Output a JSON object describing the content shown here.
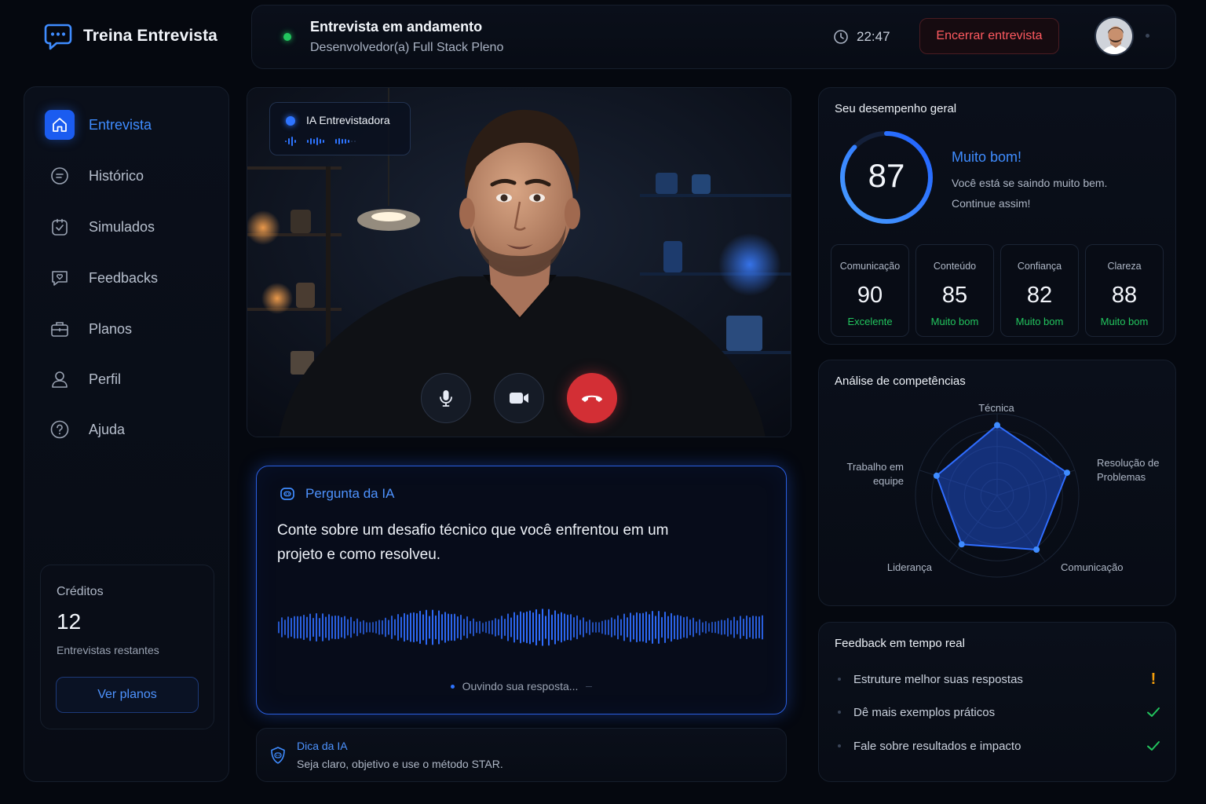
{
  "brand": {
    "name": "Treina Entrevista"
  },
  "header": {
    "status_title": "Entrevista em andamento",
    "position": "Desenvolvedor(a) Full Stack Pleno",
    "timer": "22:47",
    "end_button": "Encerrar entrevista"
  },
  "sidebar": {
    "items": [
      {
        "label": "Entrevista",
        "icon": "home-icon",
        "active": true
      },
      {
        "label": "Histórico",
        "icon": "history-icon",
        "active": false
      },
      {
        "label": "Simulados",
        "icon": "clipboard-check-icon",
        "active": false
      },
      {
        "label": "Feedbacks",
        "icon": "message-heart-icon",
        "active": false
      },
      {
        "label": "Planos",
        "icon": "briefcase-icon",
        "active": false
      },
      {
        "label": "Perfil",
        "icon": "user-icon",
        "active": false
      },
      {
        "label": "Ajuda",
        "icon": "help-circle-icon",
        "active": false
      }
    ],
    "credits": {
      "title": "Créditos",
      "count": "12",
      "subtitle": "Entrevistas restantes",
      "button": "Ver planos"
    }
  },
  "video": {
    "ai_badge": "IA Entrevistadora",
    "controls": [
      "microphone-icon",
      "camera-icon",
      "hang-up-icon"
    ]
  },
  "question": {
    "label": "Pergunta da IA",
    "text": "Conte sobre um desafio técnico que você enfrentou em um projeto e como resolveu.",
    "listening": "Ouvindo sua resposta..."
  },
  "tip": {
    "title": "Dica da IA",
    "text": "Seja claro, objetivo e use o método STAR."
  },
  "performance": {
    "title": "Seu desempenho geral",
    "score": "87",
    "score_fraction": 0.87,
    "headline": "Muito bom!",
    "message": "Você está se saindo muito bem. Continue assim!",
    "metrics": [
      {
        "label": "Comunicação",
        "value": "90",
        "status": "Excelente"
      },
      {
        "label": "Conteúdo",
        "value": "85",
        "status": "Muito bom"
      },
      {
        "label": "Confiança",
        "value": "82",
        "status": "Muito bom"
      },
      {
        "label": "Clareza",
        "value": "88",
        "status": "Muito bom"
      }
    ]
  },
  "competencies": {
    "title": "Análise de competências"
  },
  "chart_data": {
    "type": "radar",
    "categories": [
      "Técnica",
      "Resolução de Problemas",
      "Comunicação",
      "Liderança",
      "Trabalho em equipe"
    ],
    "values": [
      0.86,
      0.9,
      0.82,
      0.74,
      0.78
    ],
    "range": [
      0,
      1
    ],
    "grid": true
  },
  "feedback": {
    "title": "Feedback em tempo real",
    "items": [
      {
        "text": "Estruture melhor suas respostas",
        "status": "warning"
      },
      {
        "text": "Dê mais exemplos práticos",
        "status": "ok"
      },
      {
        "text": "Fale sobre resultados e impacto",
        "status": "ok"
      }
    ]
  },
  "colors": {
    "accent": "#2e74ff",
    "success": "#22c55e",
    "danger": "#d32f35",
    "warning": "#f59e0b"
  }
}
